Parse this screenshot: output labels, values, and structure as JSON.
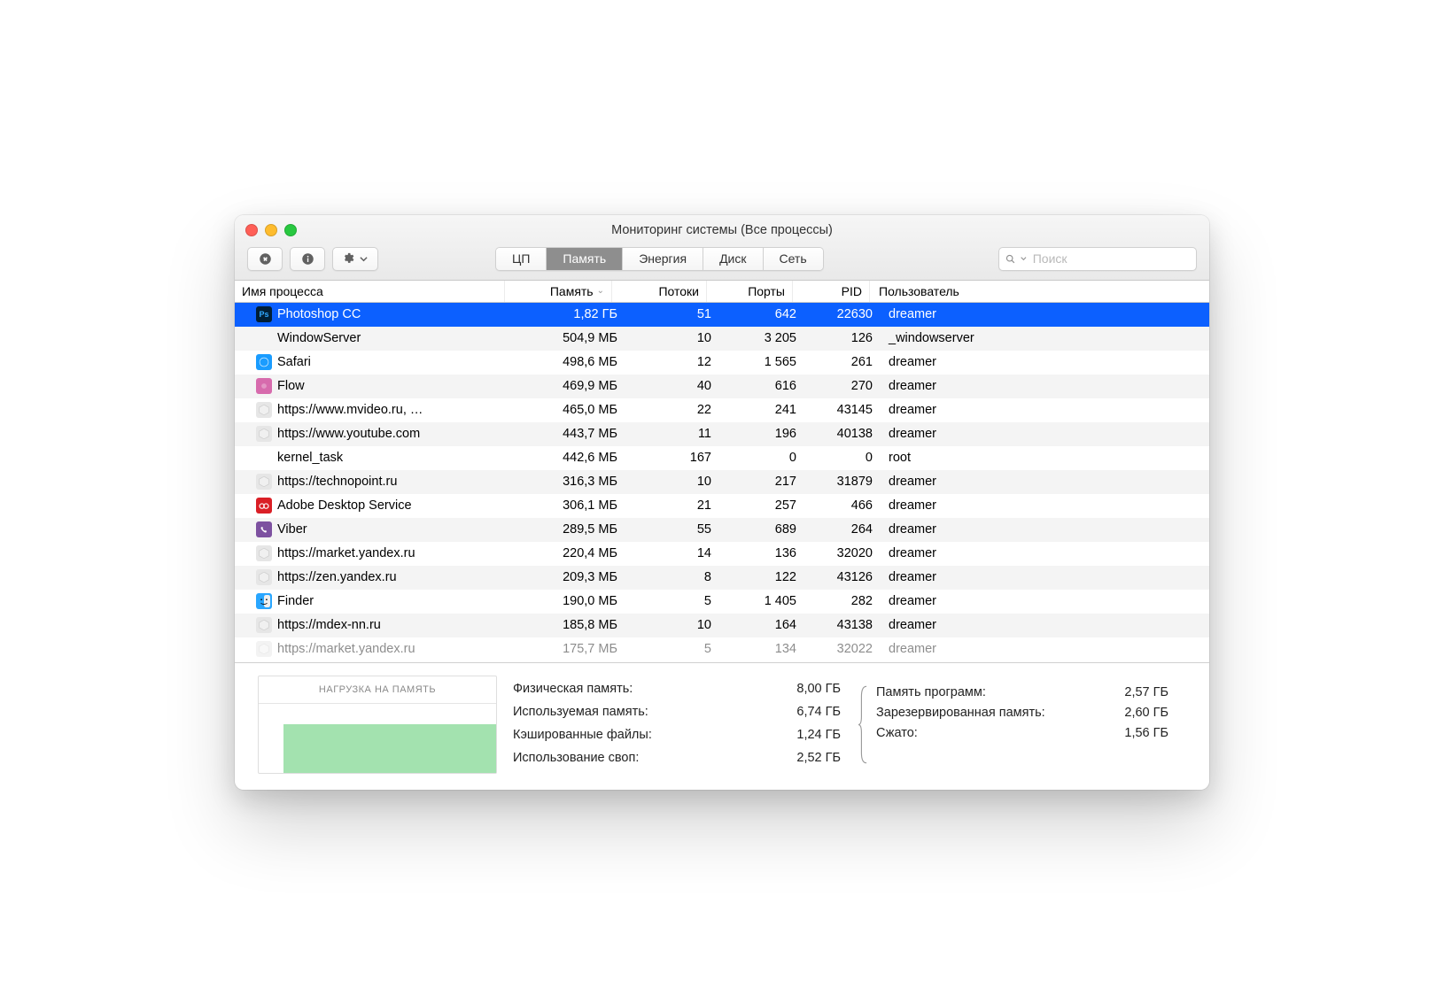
{
  "window": {
    "title": "Мониторинг системы (Все процессы)"
  },
  "toolbar": {
    "tabs": {
      "cpu": "ЦП",
      "memory": "Память",
      "energy": "Энергия",
      "disk": "Диск",
      "network": "Сеть"
    },
    "search_placeholder": "Поиск"
  },
  "columns": {
    "name": "Имя процесса",
    "memory": "Память",
    "threads": "Потоки",
    "ports": "Порты",
    "pid": "PID",
    "user": "Пользователь"
  },
  "processes": [
    {
      "name": "Photoshop CC",
      "memory": "1,82 ГБ",
      "threads": "51",
      "ports": "642",
      "pid": "22630",
      "user": "dreamer",
      "icon": "photoshop-icon",
      "icon_bg": "#001e36",
      "selected": true
    },
    {
      "name": "WindowServer",
      "memory": "504,9 МБ",
      "threads": "10",
      "ports": "3 205",
      "pid": "126",
      "user": "_windowserver",
      "icon": "",
      "icon_bg": ""
    },
    {
      "name": "Safari",
      "memory": "498,6 МБ",
      "threads": "12",
      "ports": "1 565",
      "pid": "261",
      "user": "dreamer",
      "icon": "safari-icon",
      "icon_bg": "#1a9cff"
    },
    {
      "name": "Flow",
      "memory": "469,9 МБ",
      "threads": "40",
      "ports": "616",
      "pid": "270",
      "user": "dreamer",
      "icon": "flow-icon",
      "icon_bg": "#d76bad"
    },
    {
      "name": "https://www.mvideo.ru, …",
      "memory": "465,0 МБ",
      "threads": "22",
      "ports": "241",
      "pid": "43145",
      "user": "dreamer",
      "icon": "web-process-icon",
      "icon_bg": "#e6e6e6"
    },
    {
      "name": "https://www.youtube.com",
      "memory": "443,7 МБ",
      "threads": "11",
      "ports": "196",
      "pid": "40138",
      "user": "dreamer",
      "icon": "web-process-icon",
      "icon_bg": "#e6e6e6"
    },
    {
      "name": "kernel_task",
      "memory": "442,6 МБ",
      "threads": "167",
      "ports": "0",
      "pid": "0",
      "user": "root",
      "icon": "",
      "icon_bg": ""
    },
    {
      "name": "https://technopoint.ru",
      "memory": "316,3 МБ",
      "threads": "10",
      "ports": "217",
      "pid": "31879",
      "user": "dreamer",
      "icon": "web-process-icon",
      "icon_bg": "#e6e6e6"
    },
    {
      "name": "Adobe Desktop Service",
      "memory": "306,1 МБ",
      "threads": "21",
      "ports": "257",
      "pid": "466",
      "user": "dreamer",
      "icon": "adobe-cc-icon",
      "icon_bg": "#da1f26"
    },
    {
      "name": "Viber",
      "memory": "289,5 МБ",
      "threads": "55",
      "ports": "689",
      "pid": "264",
      "user": "dreamer",
      "icon": "viber-icon",
      "icon_bg": "#7d51a0"
    },
    {
      "name": "https://market.yandex.ru",
      "memory": "220,4 МБ",
      "threads": "14",
      "ports": "136",
      "pid": "32020",
      "user": "dreamer",
      "icon": "web-process-icon",
      "icon_bg": "#e6e6e6"
    },
    {
      "name": "https://zen.yandex.ru",
      "memory": "209,3 МБ",
      "threads": "8",
      "ports": "122",
      "pid": "43126",
      "user": "dreamer",
      "icon": "web-process-icon",
      "icon_bg": "#e6e6e6"
    },
    {
      "name": "Finder",
      "memory": "190,0 МБ",
      "threads": "5",
      "ports": "1 405",
      "pid": "282",
      "user": "dreamer",
      "icon": "finder-icon",
      "icon_bg": "#29a6ff"
    },
    {
      "name": "https://mdex-nn.ru",
      "memory": "185,8 МБ",
      "threads": "10",
      "ports": "164",
      "pid": "43138",
      "user": "dreamer",
      "icon": "web-process-icon",
      "icon_bg": "#e6e6e6"
    },
    {
      "name": "https://market.yandex.ru",
      "memory": "175,7 МБ",
      "threads": "5",
      "ports": "134",
      "pid": "32022",
      "user": "dreamer",
      "icon": "web-process-icon",
      "icon_bg": "#e6e6e6",
      "partial": true
    }
  ],
  "footer": {
    "chart_title": "НАГРУЗКА НА ПАМЯТЬ",
    "left": {
      "physical_label": "Физическая память:",
      "physical_val": "8,00 ГБ",
      "used_label": "Используемая память:",
      "used_val": "6,74 ГБ",
      "cached_label": "Кэшированные файлы:",
      "cached_val": "1,24 ГБ",
      "swap_label": "Использование своп:",
      "swap_val": "2,52 ГБ"
    },
    "right": {
      "app_label": "Память программ:",
      "app_val": "2,57 ГБ",
      "wired_label": "Зарезервированная память:",
      "wired_val": "2,60 ГБ",
      "compressed_label": "Сжато:",
      "compressed_val": "1,56 ГБ"
    }
  }
}
